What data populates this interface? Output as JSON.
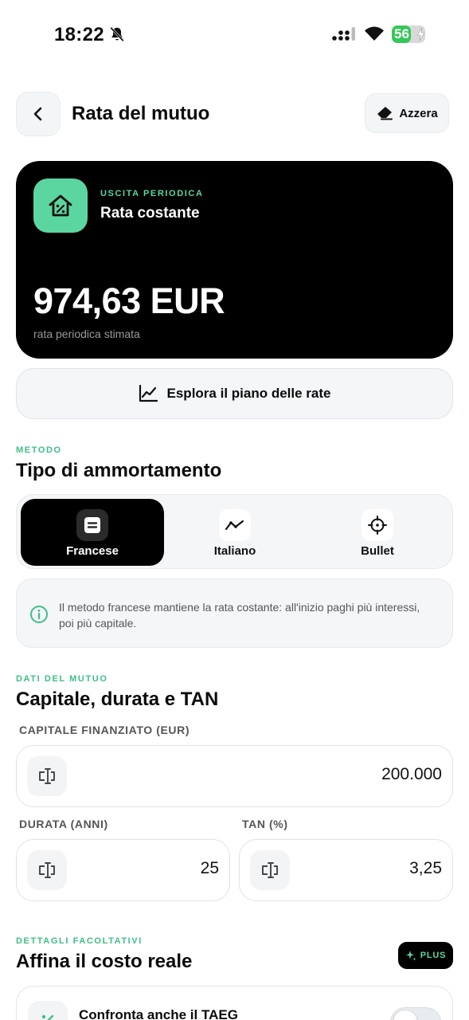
{
  "status_bar": {
    "time": "18:22",
    "battery_level": "56",
    "battery_fraction": 0.56,
    "battery_color": "#35c759"
  },
  "header": {
    "back_icon": "chevron-left-icon",
    "title": "Rata del mutuo",
    "reset_label": "Azzera",
    "reset_icon": "eraser-icon"
  },
  "hero": {
    "icon": "house-percent-icon",
    "kicker": "USCITA PERIODICA",
    "subtitle": "Rata costante",
    "amount": "974,63 EUR",
    "note": "rata periodica stimata",
    "accent_color": "#5cd6a0"
  },
  "explore_button": {
    "icon": "chart-line-icon",
    "label": "Esplora il piano delle rate"
  },
  "method_section": {
    "kicker": "METODO",
    "title": "Tipo di ammortamento",
    "options": [
      {
        "label": "Francese",
        "icon": "list-card-icon",
        "selected": true
      },
      {
        "label": "Italiano",
        "icon": "trend-line-icon",
        "selected": false
      },
      {
        "label": "Bullet",
        "icon": "crosshair-icon",
        "selected": false
      }
    ],
    "info_text": "Il metodo francese mantiene la rata costante: all'inizio paghi più interessi, poi più capitale."
  },
  "loan_section": {
    "kicker": "DATI DEL MUTUO",
    "title": "Capitale, durata e TAN",
    "capital_label": "CAPITALE FINANZIATO (EUR)",
    "capital_value": "200.000",
    "duration_label": "DURATA (ANNI)",
    "duration_value": "25",
    "rate_label": "TAN (%)",
    "rate_value": "3,25",
    "field_icon": "text-cursor-input-icon"
  },
  "optional_section": {
    "kicker": "DETTAGLI FACOLTATIVI",
    "title": "Affina il costo reale",
    "plus_label": "PLUS",
    "taeg_label": "Confronta anche il TAEG",
    "taeg_enabled": false
  }
}
